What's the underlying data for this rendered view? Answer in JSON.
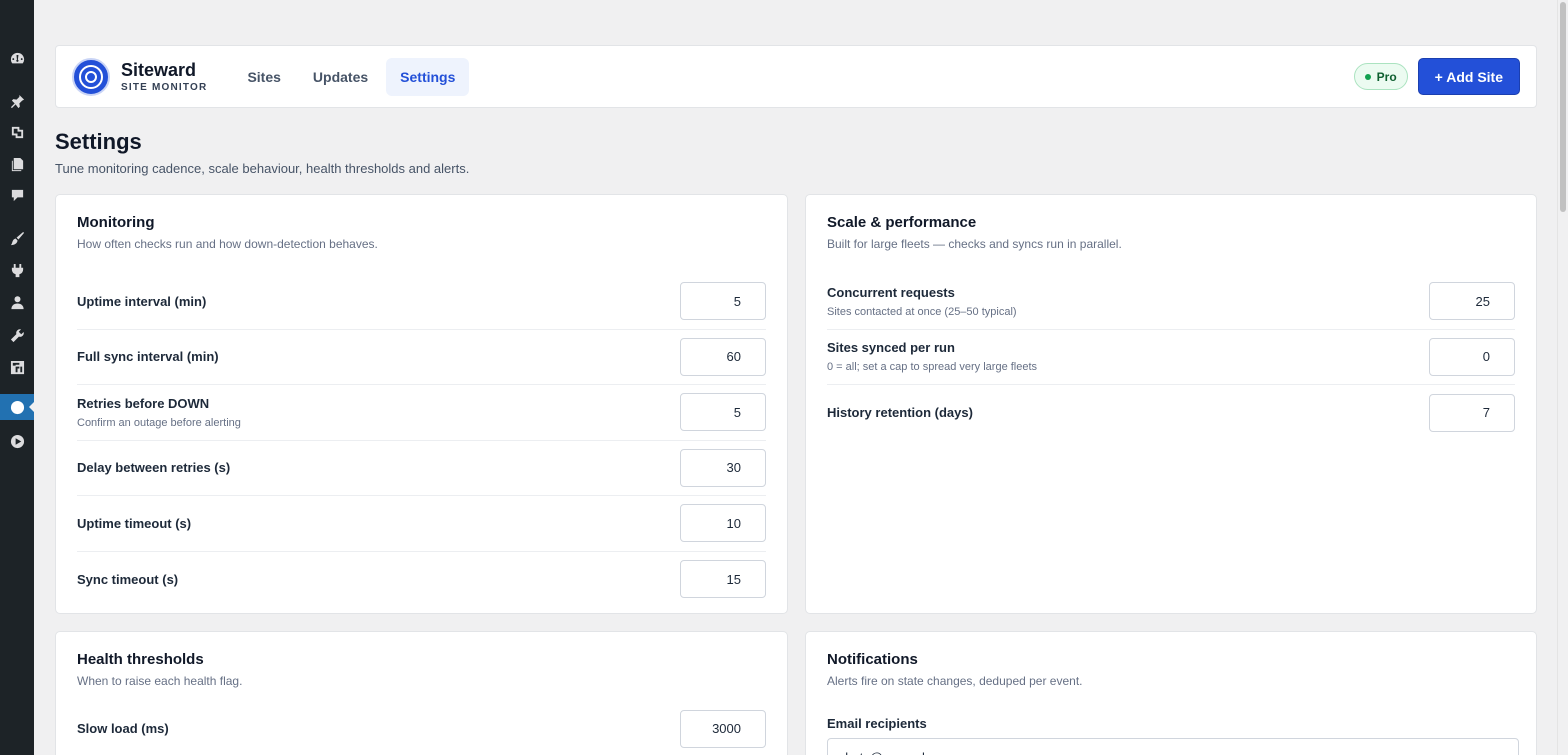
{
  "adminbar": {
    "items": [
      {
        "name": "dashboard-icon",
        "glyph": "gauge"
      },
      {
        "name": "pin-icon",
        "glyph": "pin"
      },
      {
        "name": "media-icon",
        "glyph": "media"
      },
      {
        "name": "pages-icon",
        "glyph": "pages"
      },
      {
        "name": "comments-icon",
        "glyph": "comment"
      },
      {
        "name": "appearance-icon",
        "glyph": "brush"
      },
      {
        "name": "plugins-icon",
        "glyph": "plug"
      },
      {
        "name": "users-icon",
        "glyph": "user"
      },
      {
        "name": "tools-icon",
        "glyph": "wrench"
      },
      {
        "name": "settings-icon",
        "glyph": "sliders"
      },
      {
        "name": "siteward-icon",
        "glyph": "circle",
        "active": true
      },
      {
        "name": "play-icon",
        "glyph": "play"
      }
    ]
  },
  "brand": {
    "name": "Siteward",
    "subtitle": "SITE MONITOR",
    "accent": "#2350d8"
  },
  "nav": {
    "tabs": [
      {
        "label": "Sites",
        "active": false
      },
      {
        "label": "Updates",
        "active": false
      },
      {
        "label": "Settings",
        "active": true
      }
    ]
  },
  "header": {
    "badge": "Pro",
    "add_site_label": "+ Add Site"
  },
  "page": {
    "title": "Settings",
    "description": "Tune monitoring cadence, scale behaviour, health thresholds and alerts."
  },
  "monitoring": {
    "title": "Monitoring",
    "description": "How often checks run and how down-detection behaves.",
    "rows": [
      {
        "label": "Uptime interval (min)",
        "hint": "",
        "value": "5"
      },
      {
        "label": "Full sync interval (min)",
        "hint": "",
        "value": "60"
      },
      {
        "label": "Retries before DOWN",
        "hint": "Confirm an outage before alerting",
        "value": "5"
      },
      {
        "label": "Delay between retries (s)",
        "hint": "",
        "value": "30"
      },
      {
        "label": "Uptime timeout (s)",
        "hint": "",
        "value": "10"
      },
      {
        "label": "Sync timeout (s)",
        "hint": "",
        "value": "15"
      }
    ]
  },
  "scale": {
    "title": "Scale & performance",
    "description": "Built for large fleets — checks and syncs run in parallel.",
    "rows": [
      {
        "label": "Concurrent requests",
        "hint": "Sites contacted at once (25–50 typical)",
        "value": "25"
      },
      {
        "label": "Sites synced per run",
        "hint": "0 = all; set a cap to spread very large fleets",
        "value": "0"
      },
      {
        "label": "History retention (days)",
        "hint": "",
        "value": "7"
      }
    ]
  },
  "health": {
    "title": "Health thresholds",
    "description": "When to raise each health flag.",
    "rows": [
      {
        "label": "Slow load (ms)",
        "hint": "",
        "value": "3000"
      }
    ]
  },
  "notifications": {
    "title": "Notifications",
    "description": "Alerts fire on state changes, deduped per event.",
    "email_label": "Email recipients",
    "email_value": "alerts@example.com"
  }
}
